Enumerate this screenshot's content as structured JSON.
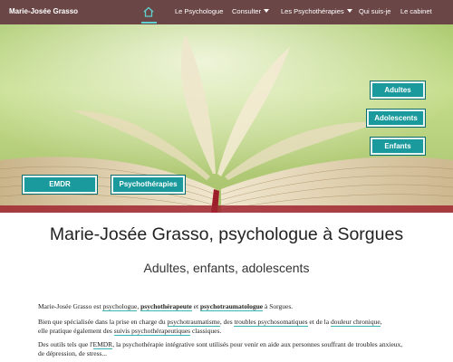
{
  "nav": {
    "brand": "Marie-Josée Grasso",
    "items": [
      {
        "label": "Le Psychologue"
      },
      {
        "label": "Consulter"
      },
      {
        "label": "Les Psychothérapies"
      },
      {
        "label": "Qui suis-je"
      },
      {
        "label": "Le cabinet"
      }
    ],
    "accent": "#5fd1d1",
    "background": "#6b4646"
  },
  "hero": {
    "buttons": {
      "adultes": "Adultes",
      "adolescents": "Adolescents",
      "enfants": "Enfants",
      "emdr": "EMDR",
      "psychotherapies": "Psychothérapies"
    },
    "button_color": "#1a9a9c"
  },
  "main": {
    "title": "Marie-Josée Grasso, psychologue à Sorgues",
    "subtitle": "Adultes, enfants, adolescents",
    "p1": {
      "a": "Marie-Josée Grasso est ",
      "b": "psychologue",
      "c": ", ",
      "d": "psychothérapeute",
      "e": " et ",
      "f": "psychotraumatologue",
      "g": " à Sorgues."
    },
    "p2": {
      "a": "Bien que spécialisée dans la prise en charge du ",
      "b": "psychotraumatisme",
      "c": ", des ",
      "d": "troubles psychosomatiques",
      "e": " et de la ",
      "f": "douleur chronique",
      "g": ",",
      "h": "elle pratique également des ",
      "i": "suivis psychothérapeutiques",
      "j": " classiques."
    },
    "p3": {
      "a": "Des outils tels que l'",
      "b": "EMDR",
      "c": ", la psychothérapie intégrative sont utilisés pour venir en aide aux personnes souffrant de troubles anxieux,",
      "d": "de dépression, de stress..."
    }
  }
}
